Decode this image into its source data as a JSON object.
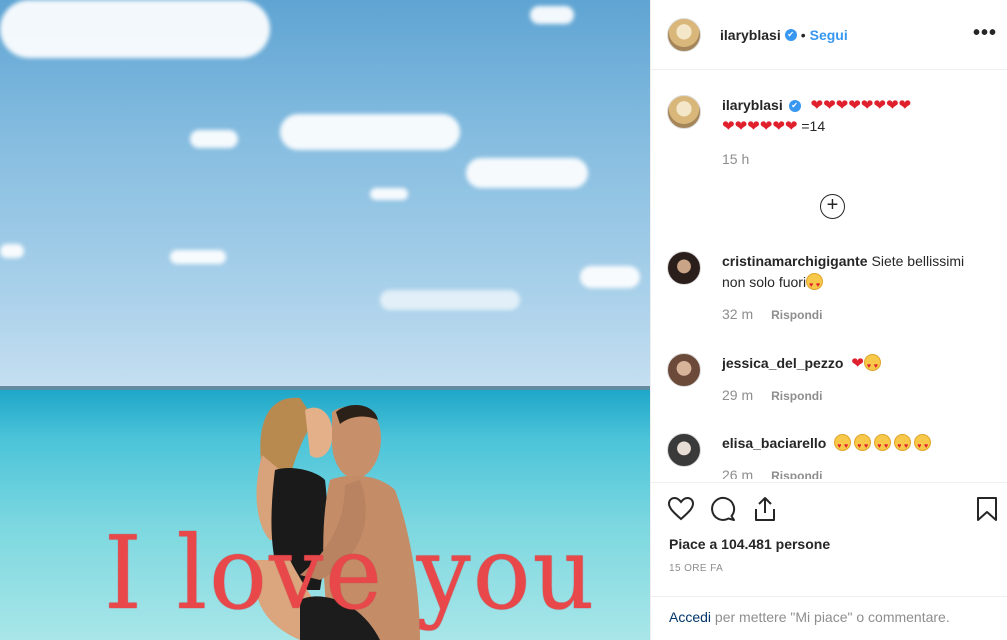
{
  "post": {
    "photo_text": "I love you"
  },
  "header": {
    "username": "ilaryblasi",
    "separator": "•",
    "follow_label": "Segui",
    "more_label": "•••"
  },
  "caption": {
    "username": "ilaryblasi",
    "suffix": "=14",
    "time": "15 h"
  },
  "load_more_label": "+",
  "comments": [
    {
      "username": "cristinamarchigigante",
      "text": "Siete bellissimi non solo fuori",
      "time": "32 m",
      "reply": "Rispondi"
    },
    {
      "username": "jessica_del_pezzo",
      "text": "",
      "time": "29 m",
      "reply": "Rispondi"
    },
    {
      "username": "elisa_baciarello",
      "text": "",
      "time": "26 m",
      "reply": "Rispondi"
    }
  ],
  "actions": {
    "likes": "Piace a 104.481 persone",
    "time": "15 ORE FA"
  },
  "login": {
    "link": "Accedi",
    "text": " per mettere \"Mi piace\" o commentare."
  },
  "colors": {
    "accent": "#3897f0",
    "heart": "#e0202c",
    "photo_text": "#e8484a"
  }
}
